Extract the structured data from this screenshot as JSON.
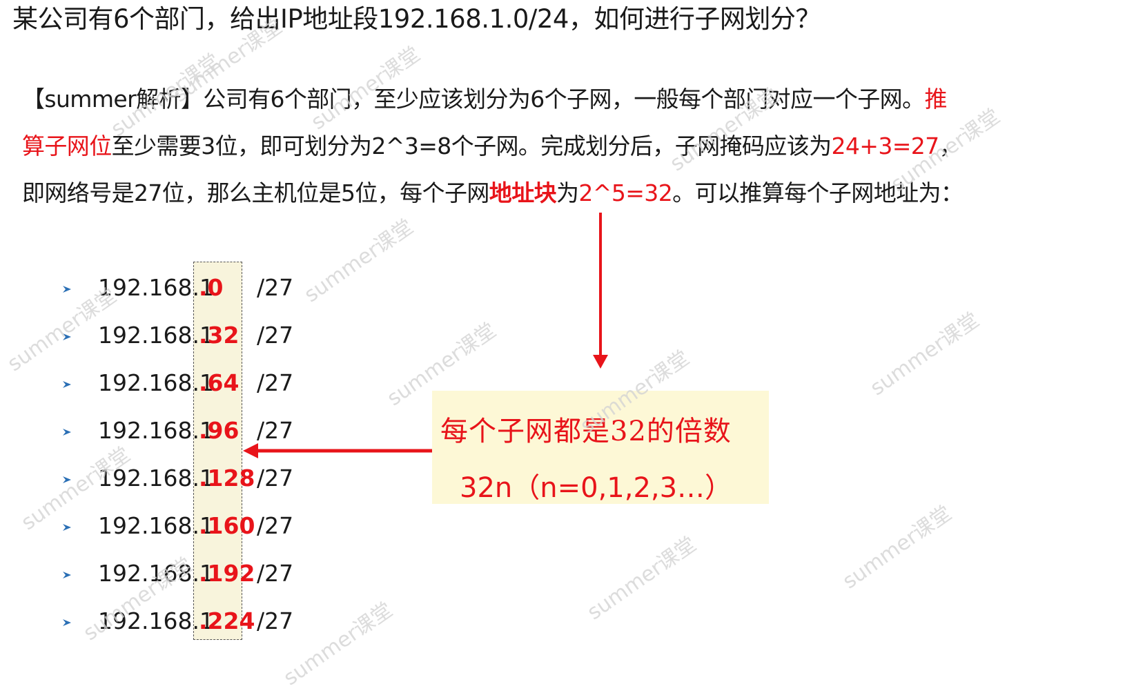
{
  "title": "某公司有6个部门，给出IP地址段192.168.1.0/24，如何进行子网划分？",
  "analysis": {
    "line1_text": "【summer解析】公司有6个部门，至少应该划分为6个子网，一般每个部门对应一个子网。",
    "line1_red": "推",
    "line2_red_start": "算子网位",
    "line2_text": "至少需要3位，即可划分为2^3=8个子网。完成划分后，子网掩码应该为",
    "line2_red_end": "24+3=27",
    "line2_tail": "，",
    "line3_text": "即网络号是27位，那么主机位是5位，每个子网",
    "line3_bold_red": "地址块",
    "line3_mid": "为",
    "line3_red": "2^5=32",
    "line3_tail": "。可以推算每个子网地址为："
  },
  "subnets": [
    {
      "prefix": "192.168.1",
      "host": ".0",
      "mask": "/27"
    },
    {
      "prefix": "192.168.1",
      "host": ".32",
      "mask": "/27"
    },
    {
      "prefix": "192.168.1",
      "host": ".64",
      "mask": "/27"
    },
    {
      "prefix": "192.168.1",
      "host": ".96",
      "mask": "/27"
    },
    {
      "prefix": "192.168.1",
      "host": ".128",
      "mask": "/27"
    },
    {
      "prefix": "192.168.1",
      "host": ".160",
      "mask": "/27"
    },
    {
      "prefix": "192.168.1",
      "host": ".192",
      "mask": "/27"
    },
    {
      "prefix": "192.168.1",
      "host": ".224",
      "mask": "/27"
    }
  ],
  "callout": {
    "line1": "每个子网都是32的倍数",
    "line2": "32n（n=0,1,2,3…）"
  },
  "watermark": "summer课堂",
  "colors": {
    "accent_red": "#e8141a",
    "highlight_bg": "#f8f4dc",
    "callout_bg": "#fdf8d6",
    "bullet_blue": "#2a6fb5"
  }
}
